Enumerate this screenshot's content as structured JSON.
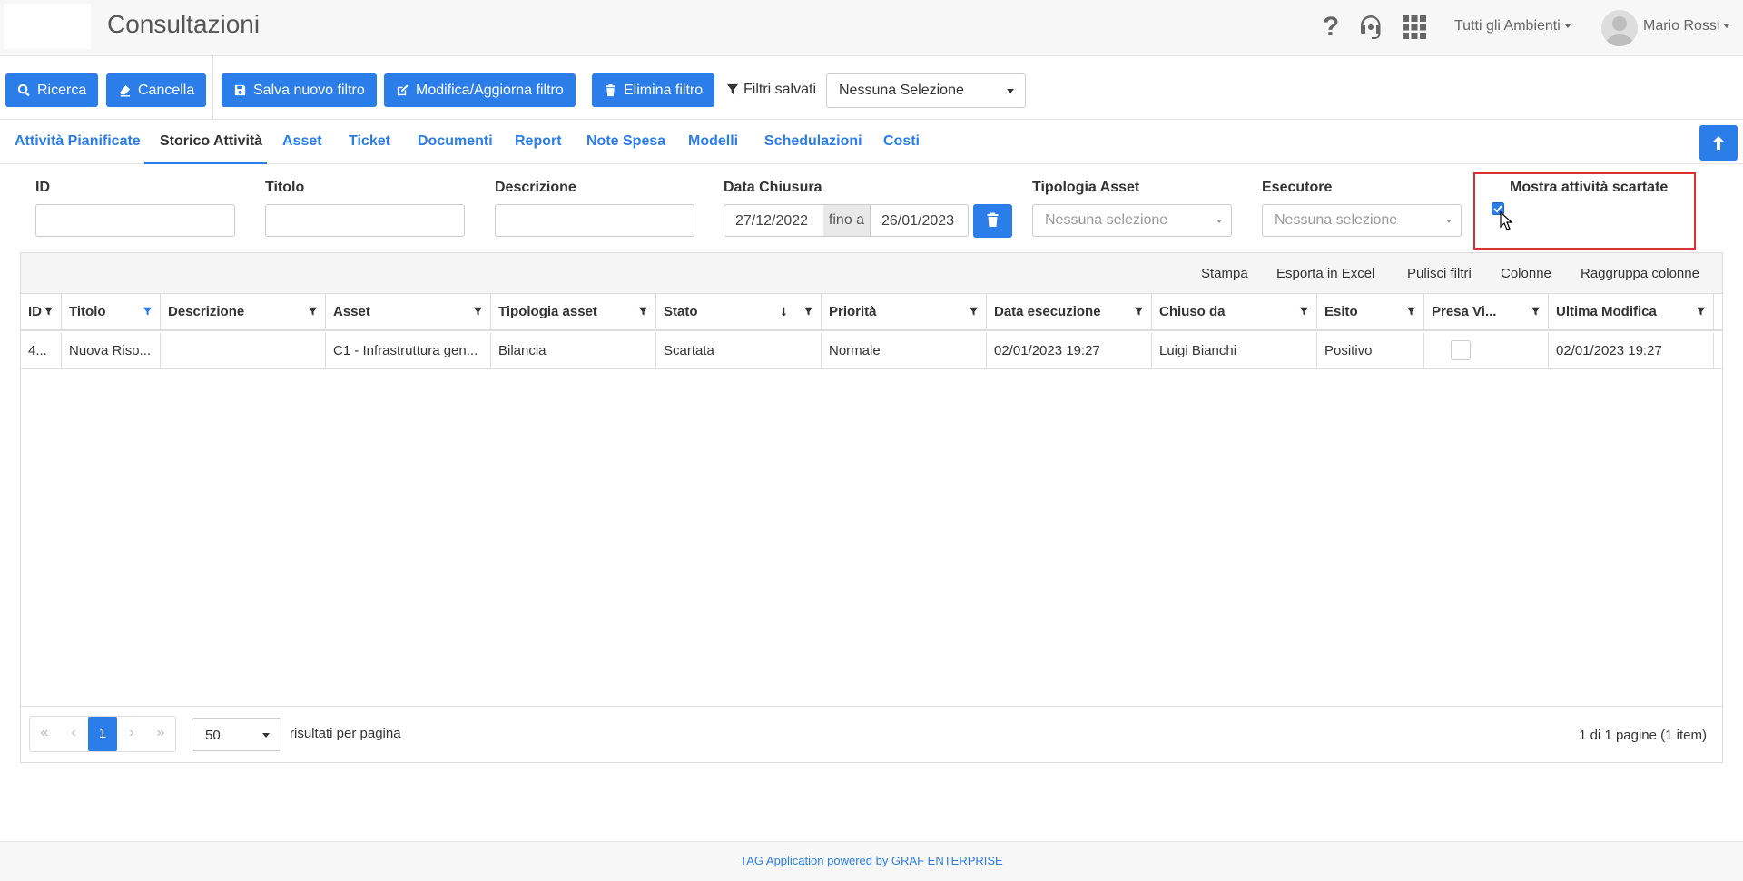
{
  "header": {
    "title": "Consultazioni",
    "environment": "Tutti gli Ambienti",
    "user": "Mario Rossi"
  },
  "toolbar": {
    "search": "Ricerca",
    "clear": "Cancella",
    "save_filter": "Salva nuovo filtro",
    "edit_filter": "Modifica/Aggiorna filtro",
    "delete_filter": "Elimina filtro",
    "saved_filters_label": "Filtri salvati",
    "saved_filters_value": "Nessuna Selezione"
  },
  "tabs": [
    "Attività Pianificate",
    "Storico Attività",
    "Asset",
    "Ticket",
    "Documenti",
    "Report",
    "Note Spesa",
    "Modelli",
    "Schedulazioni",
    "Costi"
  ],
  "filters": {
    "id_label": "ID",
    "title_label": "Titolo",
    "description_label": "Descrizione",
    "closing_date_label": "Data Chiusura",
    "date_from": "27/12/2022",
    "date_separator": "fino a",
    "date_to": "26/01/2023",
    "asset_type_label": "Tipologia Asset",
    "asset_type_placeholder": "Nessuna selezione",
    "executor_label": "Esecutore",
    "executor_placeholder": "Nessuna selezione",
    "show_discarded_label": "Mostra attività scartate",
    "show_discarded_checked": true
  },
  "grid_toolbar": {
    "print": "Stampa",
    "export": "Esporta in Excel",
    "clear_filters": "Pulisci filtri",
    "columns": "Colonne",
    "group": "Raggruppa colonne"
  },
  "columns": [
    "ID",
    "Titolo",
    "Descrizione",
    "Asset",
    "Tipologia asset",
    "Stato",
    "Priorità",
    "Data esecuzione",
    "Chiuso da",
    "Esito",
    "Presa Vi...",
    "Ultima Modifica"
  ],
  "rows": [
    [
      "4...",
      "Nuova Riso...",
      "",
      "C1 - Infrastruttura gen...",
      "Bilancia",
      "Scartata",
      "Normale",
      "02/01/2023 19:27",
      "Luigi Bianchi",
      "Positivo",
      "",
      "02/01/2023 19:27"
    ]
  ],
  "pager": {
    "current_page": "1",
    "page_size": "50",
    "per_page_label": "risultati per pagina",
    "info": "1 di 1 pagine (1 item)"
  },
  "footer": {
    "text": "TAG Application powered by GRAF ENTERPRISE"
  },
  "colors": {
    "accent": "#2b7de9",
    "highlight": "#e03030"
  }
}
